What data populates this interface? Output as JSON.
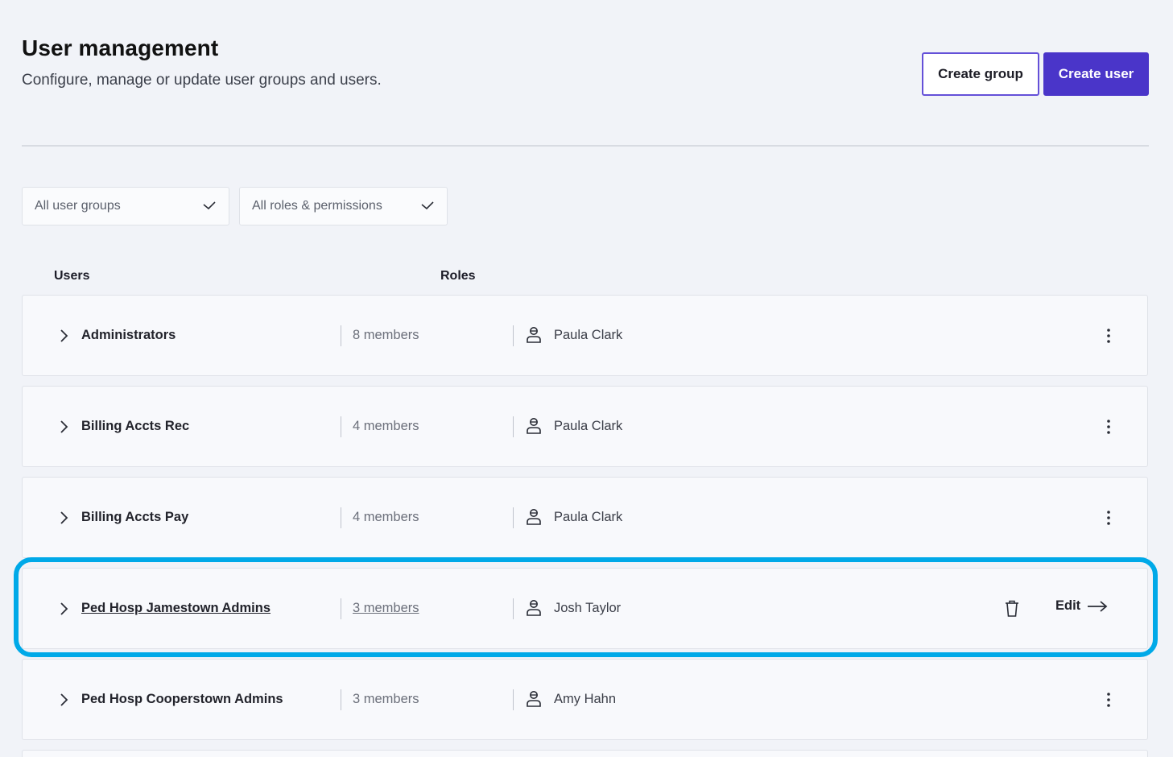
{
  "header": {
    "title": "User management",
    "subtitle": "Configure, manage or update user groups and users."
  },
  "actions": {
    "create_group": "Create group",
    "create_user": "Create user"
  },
  "filters": {
    "user_groups": "All user groups",
    "roles": "All roles & permissions"
  },
  "columns": {
    "users": "Users",
    "roles": "Roles"
  },
  "rows": [
    {
      "name": "Administrators",
      "members": "8 members",
      "owner": "Paula Clark"
    },
    {
      "name": "Billing Accts Rec",
      "members": "4 members",
      "owner": "Paula Clark"
    },
    {
      "name": "Billing Accts Pay",
      "members": "4 members",
      "owner": "Paula Clark"
    },
    {
      "name": "Ped Hosp Jamestown Admins",
      "members": "3 members",
      "owner": "Josh Taylor",
      "edit_label": "Edit"
    },
    {
      "name": "Ped Hosp Cooperstown Admins",
      "members": "3 members",
      "owner": "Amy Hahn"
    }
  ],
  "colors": {
    "primary": "#4a35c9",
    "highlight": "#00a9e8",
    "background": "#f1f3f8"
  }
}
